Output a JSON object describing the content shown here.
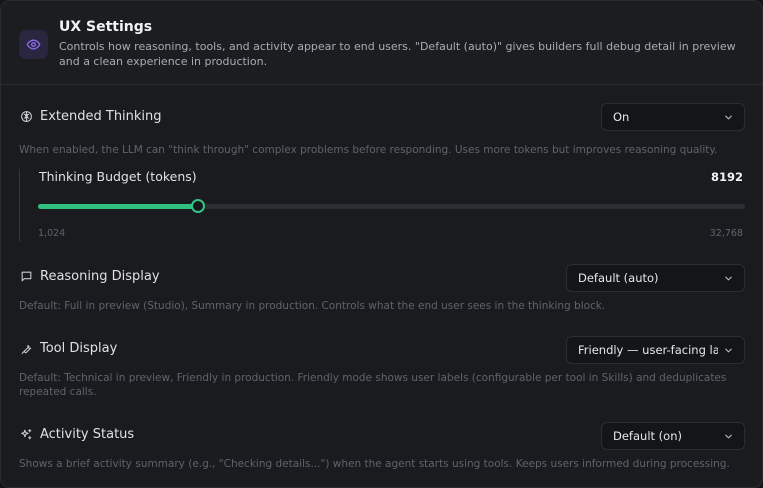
{
  "header": {
    "title": "UX Settings",
    "description": "Controls how reasoning, tools, and activity appear to end users. \"Default (auto)\" gives builders full debug detail in preview and a clean experience in production."
  },
  "extended_thinking": {
    "title": "Extended Thinking",
    "value": "On",
    "description": "When enabled, the LLM can \"think through\" complex problems before responding. Uses more tokens but improves reasoning quality.",
    "budget": {
      "label": "Thinking Budget (tokens)",
      "value": 8192,
      "value_label": "8192",
      "min_label": "1,024",
      "max_label": "32,768",
      "min": 1024,
      "max": 32768
    }
  },
  "reasoning_display": {
    "title": "Reasoning Display",
    "value": "Default (auto)",
    "description": "Default: Full in preview (Studio), Summary in production. Controls what the end user sees in the thinking block."
  },
  "tool_display": {
    "title": "Tool Display",
    "value": "Friendly — user-facing labels",
    "description": "Default: Technical in preview, Friendly in production. Friendly mode shows user labels (configurable per tool in Skills) and deduplicates repeated calls."
  },
  "activity_status": {
    "title": "Activity Status",
    "value": "Default (on)",
    "description": "Shows a brief activity summary (e.g., \"Checking details...\") when the agent starts using tools. Keeps users informed during processing."
  },
  "colors": {
    "accent": "#2fbf7f",
    "icon_accent": "#8b6cf0"
  },
  "icons": {
    "header": "eye-icon",
    "extended_thinking": "brain-icon",
    "reasoning_display": "chat-bubble-icon",
    "tool_display": "wrench-icon",
    "activity_status": "sparkles-icon",
    "select": "chevron-down-icon"
  }
}
